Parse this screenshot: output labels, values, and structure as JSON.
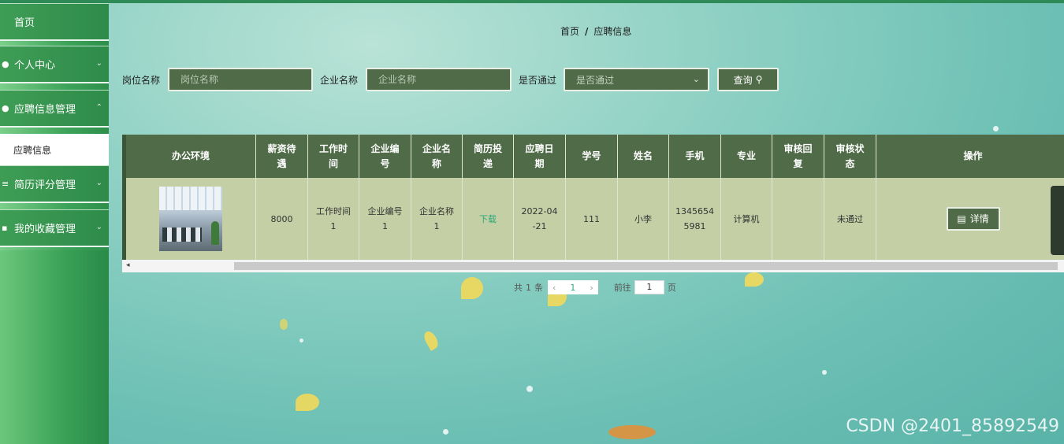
{
  "sidebar": {
    "items": [
      {
        "label": "首页",
        "icon": "home-icon"
      },
      {
        "label": "个人中心",
        "icon": "user-icon"
      },
      {
        "label": "应聘信息管理",
        "icon": "pin-icon"
      },
      {
        "label": "简历评分管理",
        "icon": "list-icon"
      },
      {
        "label": "我的收藏管理",
        "icon": "grid-icon"
      }
    ],
    "active_sub": "应聘信息"
  },
  "breadcrumb": {
    "home": "首页",
    "sep": "/",
    "current": "应聘信息"
  },
  "search": {
    "job_label": "岗位名称",
    "job_placeholder": "岗位名称",
    "company_label": "企业名称",
    "company_placeholder": "企业名称",
    "pass_label": "是否通过",
    "pass_placeholder": "是否通过",
    "button": "查询"
  },
  "table": {
    "headers": [
      "办公环境",
      "薪资待遇",
      "工作时间",
      "企业编号",
      "企业名称",
      "简历投递",
      "应聘日期",
      "学号",
      "姓名",
      "手机",
      "专业",
      "审核回复",
      "审核状态",
      "操作"
    ],
    "rows": [
      {
        "salary": "8000",
        "work_time": "工作时间1",
        "company_no": "企业编号1",
        "company_name": "企业名称1",
        "resume": "下载",
        "date": "2022-04-21",
        "student_no": "111",
        "name": "小李",
        "phone": "13456545981",
        "major": "计算机",
        "reply": "",
        "status": "未通过",
        "action": "详情"
      }
    ]
  },
  "pagination": {
    "total_prefix": "共",
    "total": "1",
    "total_suffix": "条",
    "current_page": "1",
    "goto_label": "前往",
    "goto_value": "1",
    "page_suffix": "页"
  },
  "watermark": "CSDN @2401_85892549",
  "colors": {
    "sidebar": "#2e8b4a",
    "control": "#4f6b47",
    "body_row": "#c4cfa5",
    "link": "#2aa87a"
  }
}
